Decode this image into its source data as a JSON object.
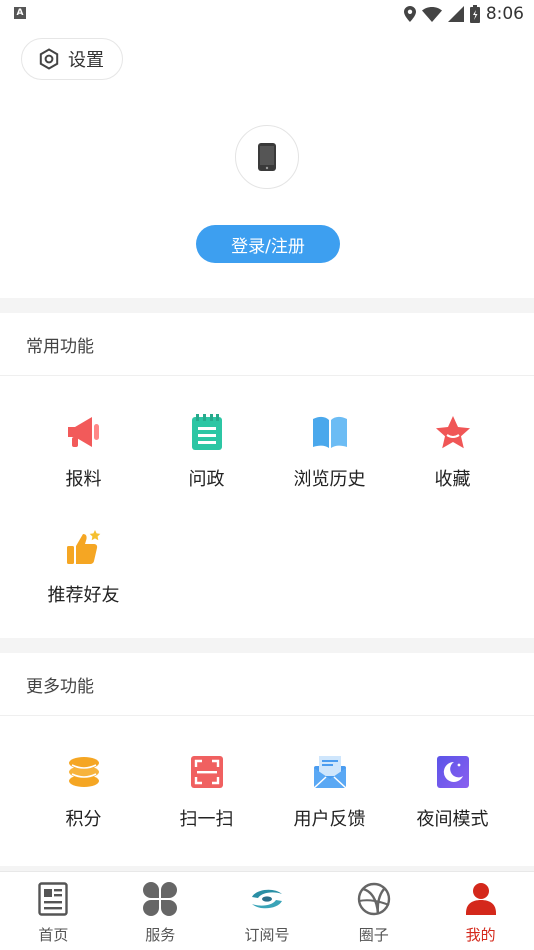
{
  "status_bar": {
    "left_badge": "A",
    "time": "8:06"
  },
  "profile": {
    "settings_label": "设置",
    "login_label": "登录/注册"
  },
  "common": {
    "title": "常用功能",
    "items": [
      {
        "label": "报料",
        "icon": "megaphone-icon"
      },
      {
        "label": "问政",
        "icon": "notepad-icon"
      },
      {
        "label": "浏览历史",
        "icon": "open-book-icon"
      },
      {
        "label": "收藏",
        "icon": "star-icon"
      },
      {
        "label": "推荐好友",
        "icon": "thumbs-up-icon"
      }
    ]
  },
  "more": {
    "title": "更多功能",
    "items": [
      {
        "label": "积分",
        "icon": "coins-icon"
      },
      {
        "label": "扫一扫",
        "icon": "scan-icon"
      },
      {
        "label": "用户反馈",
        "icon": "mail-icon"
      },
      {
        "label": "夜间模式",
        "icon": "moon-icon"
      }
    ]
  },
  "tabs": [
    {
      "label": "首页",
      "icon": "newspaper-icon",
      "active": false
    },
    {
      "label": "服务",
      "icon": "grid-icon",
      "active": false
    },
    {
      "label": "订阅号",
      "icon": "subscribe-icon",
      "active": false
    },
    {
      "label": "圈子",
      "icon": "globe-icon",
      "active": false
    },
    {
      "label": "我的",
      "icon": "user-icon",
      "active": true
    }
  ],
  "colors": {
    "accent": "#3d9ff0",
    "active_tab": "#d4281b",
    "divider": "#f4f4f4"
  }
}
